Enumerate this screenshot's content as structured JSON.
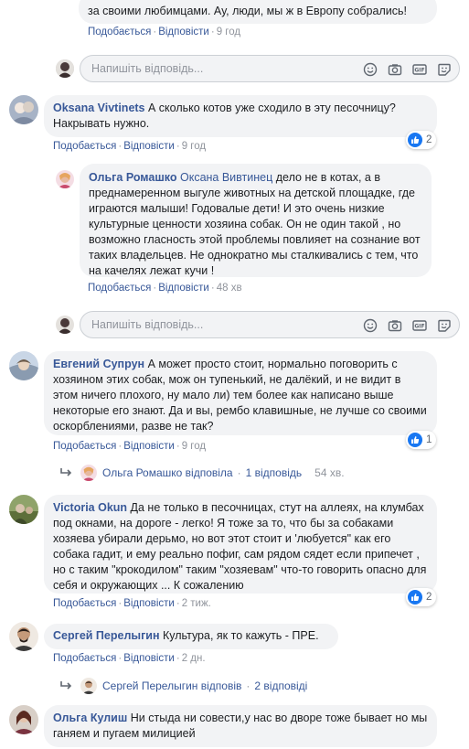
{
  "comments": {
    "top": {
      "text": "за своими любимцами. Ау, люди, мы ж в Европу собрались!",
      "like": "Подобається",
      "reply": "Відповісти",
      "time": "9 год"
    },
    "reply_box_placeholder": "Напишіть відповідь...",
    "c1": {
      "author": "Oksana Vivtinets",
      "text": "А сколько котов уже сходило в эту песочницу? Накрывать нужно.",
      "like": "Подобається",
      "reply": "Відповісти",
      "time": "9 год",
      "reactions": "2"
    },
    "c1_reply": {
      "author": "Ольга Ромашко",
      "mention": "Оксана Вивтинец",
      "text": "дело не в котах, а в преднамеренном выгуле животных на детской площадке, где играются малыши! Годовалые дети! И это очень низкие культурные ценности хозяина собак. Он не один такой , но возможно гласность этой проблемы повлияет на сознание вот таких владельцев. Не однократно мы сталкивались с тем, что на качелях лежат кучи !",
      "like": "Подобається",
      "reply": "Відповісти",
      "time": "48 хв"
    },
    "c2": {
      "author": "Евгений Супрун",
      "text": "А может просто стоит, нормально поговорить с хозяином этих собак, мож он тупенький, не далёкий, и не видит в этом ничего плохого, ну мало ли) тем более как написано выше некоторые его знают. Да и вы, рембо клавишные, не лучше со своими оскорблениями, разве не так?",
      "like": "Подобається",
      "reply": "Відповісти",
      "time": "9 год",
      "reactions": "1",
      "replies_summary": {
        "who": "Ольга Ромашко відповіла",
        "count": "1 відповідь",
        "time": "54 хв."
      }
    },
    "c3": {
      "author": "Victoria Okun",
      "text": "Да не только в песочницах, стут на аллеях, на клумбах под окнами, на дороге - легко! Я тоже за то, что бы за собаками хозяева убирали дерьмо, но вот этот стоит и 'любуется\" как его собака гадит, и ему реально пофиг, сам рядом сядет если припечет , но с таким \"крокодилом\" таким \"хозяевам\" что-то говорить опасно для себя и окружающих ... К сожалению",
      "like": "Подобається",
      "reply": "Відповісти",
      "time": "2 тиж.",
      "reactions": "2"
    },
    "c4": {
      "author": "Сергей Перелыгин",
      "text": "Культура, як то кажуть - ПРЕ.",
      "like": "Подобається",
      "reply": "Відповісти",
      "time": "2 дн.",
      "replies_summary": {
        "who": "Сергей Перелыгин відповів",
        "count": "2 відповіді"
      }
    },
    "c5": {
      "author": "Ольга Кулиш",
      "text": "Ни стыда ни совести,у нас во дворе тоже бывает но мы ганяем и пугаем милицией"
    }
  },
  "colors": {
    "link": "#385898",
    "like_blue": "#1877f2",
    "bubble": "#f2f3f5",
    "meta": "#606770"
  }
}
